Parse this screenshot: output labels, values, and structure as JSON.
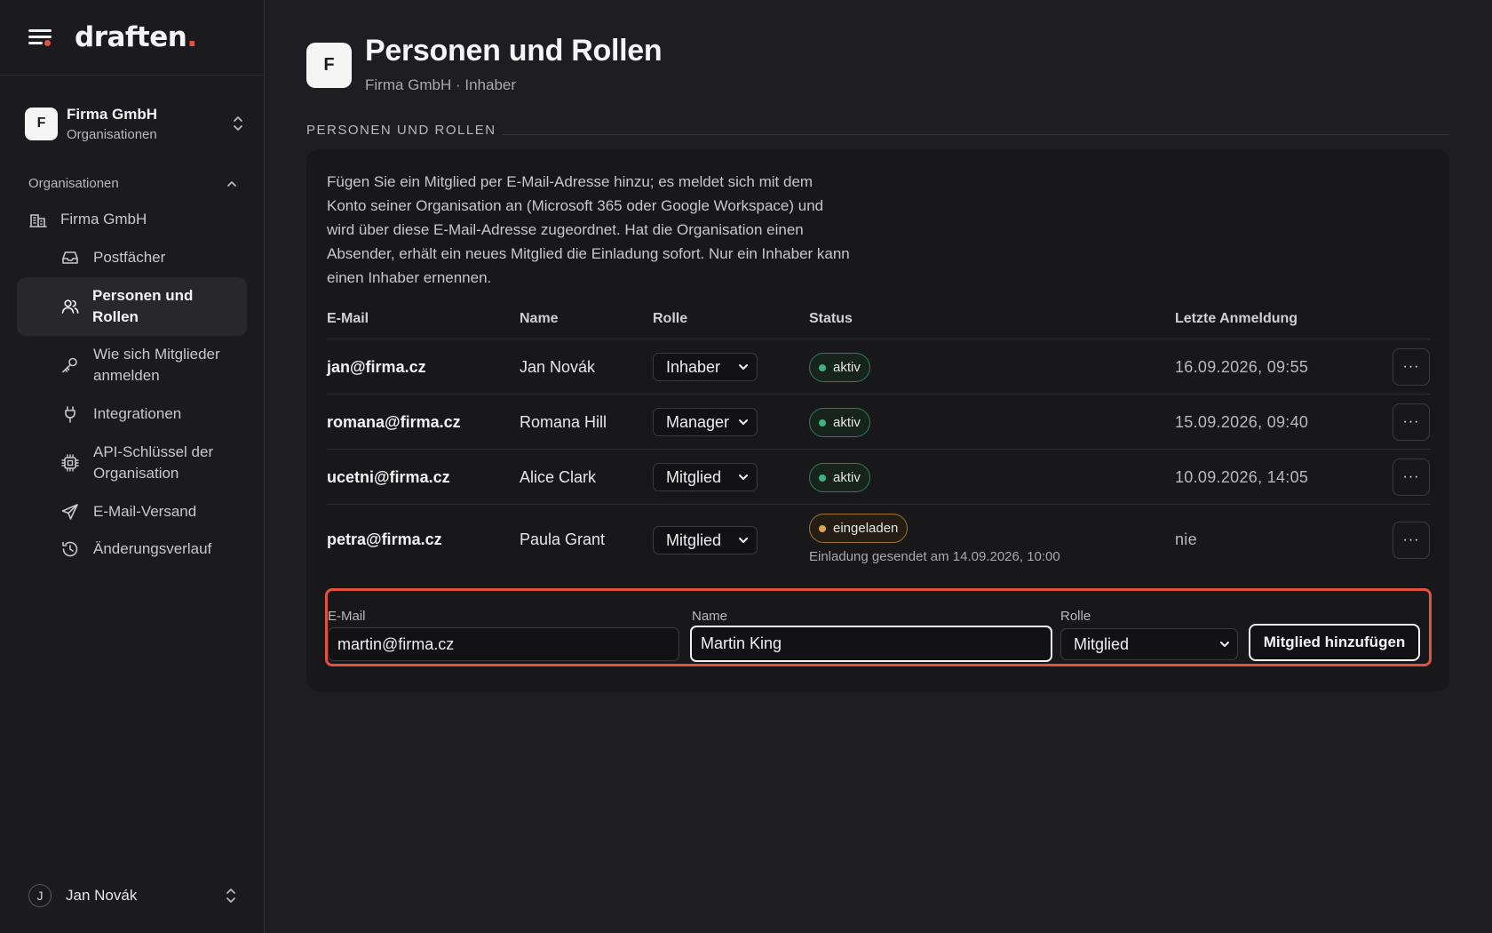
{
  "app": {
    "logo_text": "draften",
    "logo_dot": "."
  },
  "org_switcher": {
    "avatar": "F",
    "name": "Firma GmbH",
    "subtitle": "Organisationen"
  },
  "sidebar": {
    "section_label": "Organisationen",
    "org_item": "Firma GmbH",
    "items": [
      {
        "label": "Postfächer",
        "icon": "inbox-icon"
      },
      {
        "label": "Personen und Rollen",
        "icon": "users-icon",
        "active": true
      },
      {
        "label": "Wie sich Mitglieder anmelden",
        "icon": "key-icon"
      },
      {
        "label": "Integrationen",
        "icon": "plug-icon"
      },
      {
        "label": "API-Schlüssel der Organisation",
        "icon": "chip-icon"
      },
      {
        "label": "E-Mail-Versand",
        "icon": "send-icon"
      },
      {
        "label": "Änderungsverlauf",
        "icon": "history-icon"
      }
    ]
  },
  "user": {
    "avatar": "J",
    "name": "Jan Novák"
  },
  "header": {
    "avatar": "F",
    "title": "Personen und Rollen",
    "subtitle": "Firma GmbH · Inhaber"
  },
  "section": {
    "title": "PERSONEN UND ROLLEN"
  },
  "intro": "Fügen Sie ein Mitglied per E-Mail-Adresse hinzu; es meldet sich mit dem Konto seiner Organisation an (Microsoft 365 oder Google Workspace) und wird über diese E-Mail-Adresse zugeordnet. Hat die Organisation einen Absender, erhält ein neues Mitglied die Einladung sofort. Nur ein Inhaber kann einen Inhaber ernennen.",
  "table": {
    "columns": {
      "email": "E-Mail",
      "name": "Name",
      "role": "Rolle",
      "status": "Status",
      "last_login": "Letzte Anmeldung"
    },
    "rows": [
      {
        "email": "jan@firma.cz",
        "name": "Jan Novák",
        "role": "Inhaber",
        "status": "aktiv",
        "last_login": "16.09.2026, 09:55"
      },
      {
        "email": "romana@firma.cz",
        "name": "Romana Hill",
        "role": "Manager",
        "status": "aktiv",
        "last_login": "15.09.2026, 09:40"
      },
      {
        "email": "ucetni@firma.cz",
        "name": "Alice Clark",
        "role": "Mitglied",
        "status": "aktiv",
        "last_login": "10.09.2026, 14:05"
      },
      {
        "email": "petra@firma.cz",
        "name": "Paula Grant",
        "role": "Mitglied",
        "status": "eingeladen",
        "status_note": "Einladung gesendet am 14.09.2026, 10:00",
        "last_login": "nie"
      }
    ],
    "more_label": "···"
  },
  "add_form": {
    "email_label": "E-Mail",
    "email_value": "martin@firma.cz",
    "name_label": "Name",
    "name_value": "Martin King",
    "role_label": "Rolle",
    "role_value": "Mitglied",
    "submit_label": "Mitglied hinzufügen"
  },
  "colors": {
    "accent": "#e2523e",
    "status_active": "#3fb37f",
    "status_invited": "#e0a24a"
  }
}
